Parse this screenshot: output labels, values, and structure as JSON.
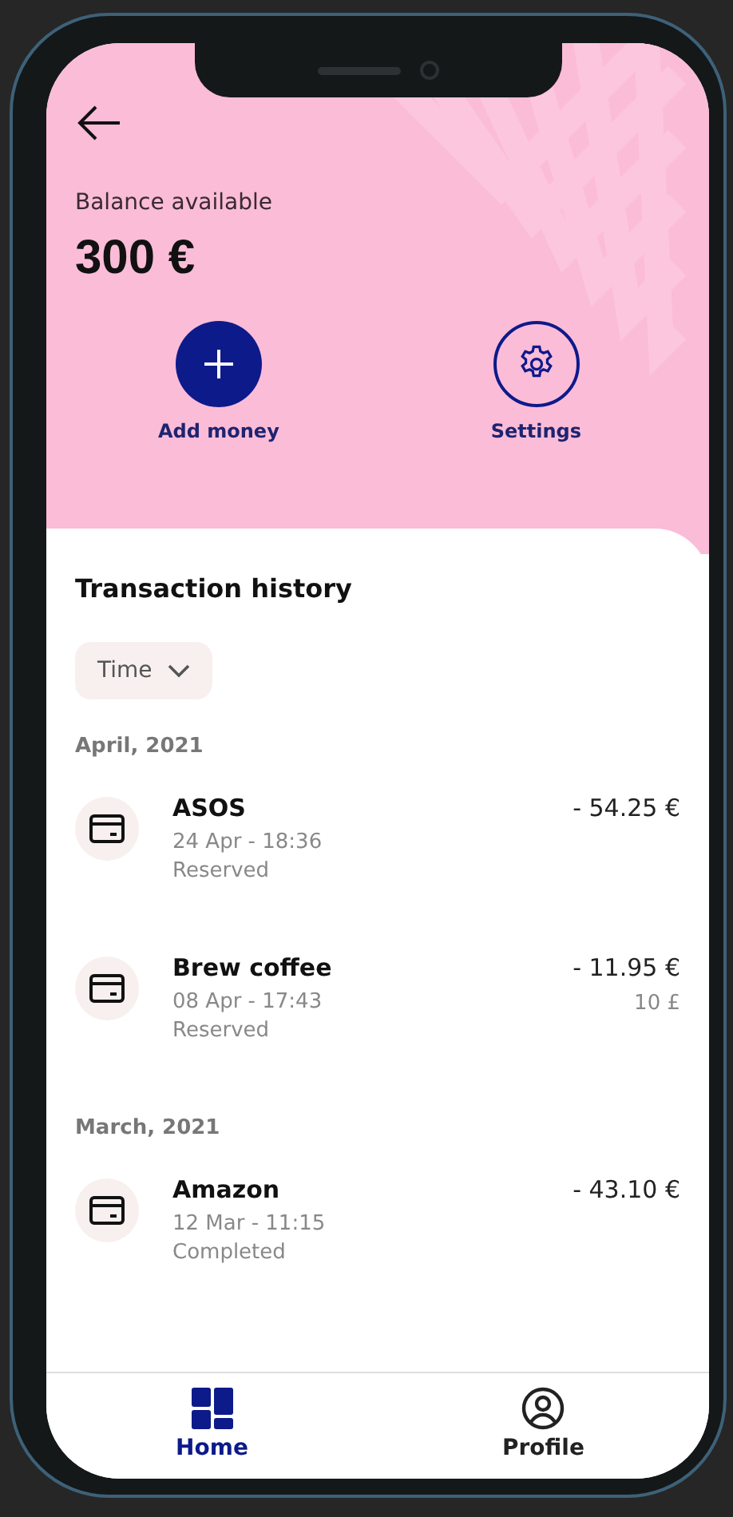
{
  "header": {
    "balance_label": "Balance available",
    "balance": "300 €",
    "actions": [
      {
        "label": "Add money",
        "kind": "add"
      },
      {
        "label": "Settings",
        "kind": "settings"
      }
    ]
  },
  "history": {
    "title": "Transaction history",
    "filter": "Time",
    "groups": [
      {
        "month": "April, 2021",
        "transactions": [
          {
            "name": "ASOS",
            "datetime": "24 Apr - 18:36",
            "status": "Reserved",
            "amount": "- 54.25 €"
          },
          {
            "name": "Brew coffee",
            "datetime": "08 Apr - 17:43",
            "status": "Reserved",
            "amount": "- 11.95 €",
            "original_amount": "10 £"
          }
        ]
      },
      {
        "month": "March, 2021",
        "transactions": [
          {
            "name": "Amazon",
            "datetime": "12 Mar - 11:15",
            "status": "Completed",
            "amount": "- 43.10 €"
          }
        ]
      }
    ]
  },
  "nav": [
    {
      "label": "Home",
      "kind": "home",
      "selected": true
    },
    {
      "label": "Profile",
      "kind": "profile",
      "selected": false
    }
  ]
}
